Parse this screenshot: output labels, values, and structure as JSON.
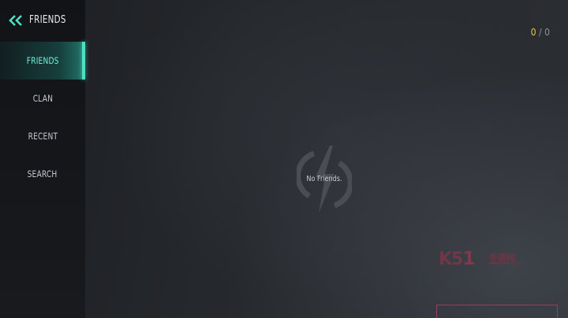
{
  "header": {
    "title": "FRIENDS",
    "back_icon": "double-chevron-left-icon",
    "accent_color": "#4fe0c2"
  },
  "tabs": [
    {
      "label": "FRIENDS",
      "active": true
    },
    {
      "label": "CLAN",
      "active": false
    },
    {
      "label": "RECENT",
      "active": false
    },
    {
      "label": "SEARCH",
      "active": false
    }
  ],
  "counter": {
    "current": "0",
    "separator": " / ",
    "max": "0",
    "current_color": "#e8c64a"
  },
  "empty_state": {
    "message": "No Friends.",
    "icon": "lightning-emblem-icon"
  },
  "watermark": {
    "mark": "K5",
    "mark_digit": "1",
    "text": "手游网"
  }
}
